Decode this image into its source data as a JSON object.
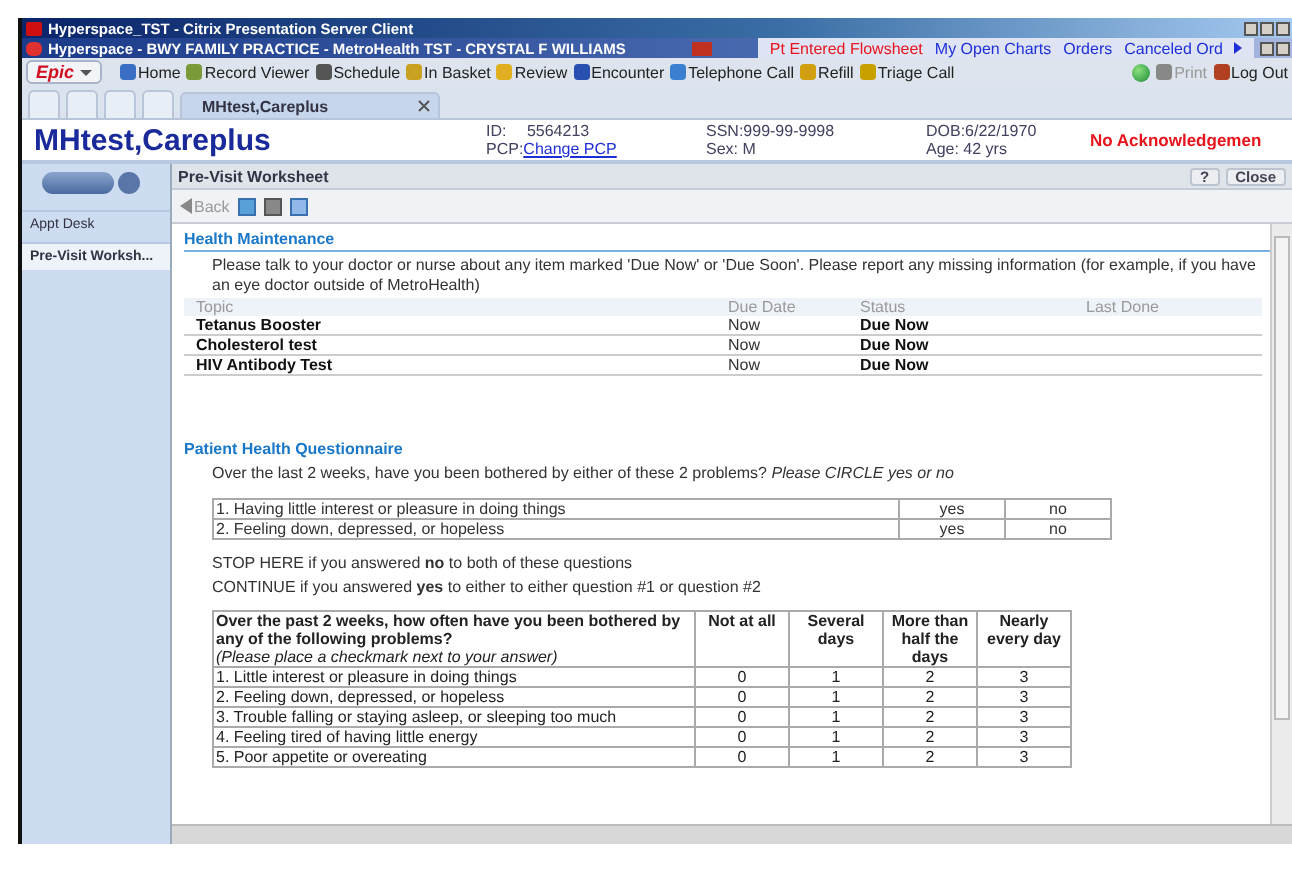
{
  "citrix_title": "Hyperspace_TST - Citrix Presentation Server Client",
  "window_title": "Hyperspace - BWY FAMILY PRACTICE - MetroHealth TST - CRYSTAL F WILLIAMS",
  "header_links": [
    {
      "label": "Pt Entered Flowsheet",
      "color": "#e8141c"
    },
    {
      "label": "My Open Charts",
      "color": "#1f2fd8"
    },
    {
      "label": "Orders",
      "color": "#1f2fd8"
    },
    {
      "label": "Canceled Ord",
      "color": "#1f2fd8"
    }
  ],
  "epic_button": "Epic",
  "toolbar": [
    {
      "label": "Home",
      "kind": "house"
    },
    {
      "label": "Record Viewer",
      "kind": "doc"
    },
    {
      "label": "Schedule",
      "kind": "grid"
    },
    {
      "label": "In Basket",
      "kind": "mail"
    },
    {
      "label": "Review",
      "kind": "folder"
    },
    {
      "label": "Encounter",
      "kind": "people"
    },
    {
      "label": "Telephone Call",
      "kind": "phone"
    },
    {
      "label": "Refill",
      "kind": "pill"
    },
    {
      "label": "Triage Call",
      "kind": "bell"
    }
  ],
  "toolbar_right": [
    {
      "label": "Print",
      "kind": "print",
      "disabled": true
    },
    {
      "label": "Log Out",
      "kind": "logout",
      "disabled": false
    }
  ],
  "tab": {
    "label": "MHtest,Careplus",
    "selected": true
  },
  "patient": {
    "name": "MHtest,Careplus",
    "id_label": "ID:",
    "id": "5564213",
    "pcp_label": "PCP:",
    "pcp_link": "Change PCP",
    "ssn": "SSN:999-99-9998",
    "sex": "Sex: M",
    "dob": "DOB:6/22/1970",
    "age": "Age: 42 yrs",
    "alert": "No Acknowledgemen"
  },
  "sidebar": [
    {
      "label": "Appt Desk",
      "selected": false
    },
    {
      "label": "Pre-Visit Worksh...",
      "selected": true
    }
  ],
  "activity": {
    "title": "Pre-Visit Worksheet",
    "help": "?",
    "close": "Close",
    "back": "Back"
  },
  "health_maintenance": {
    "title": "Health Maintenance",
    "intro": "Please talk to your doctor or nurse about any item marked 'Due Now' or 'Due Soon'.  Please report any missing information (for example, if you have an eye doctor outside of MetroHealth)",
    "columns": [
      "Topic",
      "Due Date",
      "Status",
      "Last Done"
    ],
    "rows": [
      [
        "Tetanus Booster",
        "Now",
        "Due Now",
        ""
      ],
      [
        "Cholesterol test",
        "Now",
        "Due Now",
        ""
      ],
      [
        "HIV Antibody Test",
        "Now",
        "Due Now",
        ""
      ]
    ]
  },
  "phq": {
    "title": "Patient Health Questionnaire",
    "intro": "Over the last 2 weeks, have you been bothered by either of these 2 problems? *Please CIRCLE yes or no*",
    "screen_rows": [
      [
        "1. Having little interest or pleasure in doing things",
        "yes",
        "no"
      ],
      [
        "2. Feeling down, depressed, or hopeless",
        "yes",
        "no"
      ]
    ],
    "stop": "STOP HERE if you answered **no** to both of these questions",
    "continue": "CONTINUE if you answered **yes** to either to either question #1 or question #2",
    "columns": [
      {
        "text": "Over the past 2 weeks, how often have you been bothered by any of the following problems?",
        "note": "(Please place a checkmark next to your answer)"
      },
      {
        "text": "Not at all"
      },
      {
        "text": "Several days"
      },
      {
        "text": "More than half the days"
      },
      {
        "text": "Nearly every day"
      }
    ],
    "rows": [
      [
        "1. Little interest or pleasure in doing things",
        "0",
        "1",
        "2",
        "3"
      ],
      [
        "2. Feeling down, depressed, or hopeless",
        "0",
        "1",
        "2",
        "3"
      ],
      [
        "3. Trouble falling or staying asleep, or sleeping too much",
        "0",
        "1",
        "2",
        "3"
      ],
      [
        "4. Feeling tired of having little energy",
        "0",
        "1",
        "2",
        "3"
      ],
      [
        "5. Poor appetite or overeating",
        "0",
        "1",
        "2",
        "3"
      ]
    ]
  }
}
